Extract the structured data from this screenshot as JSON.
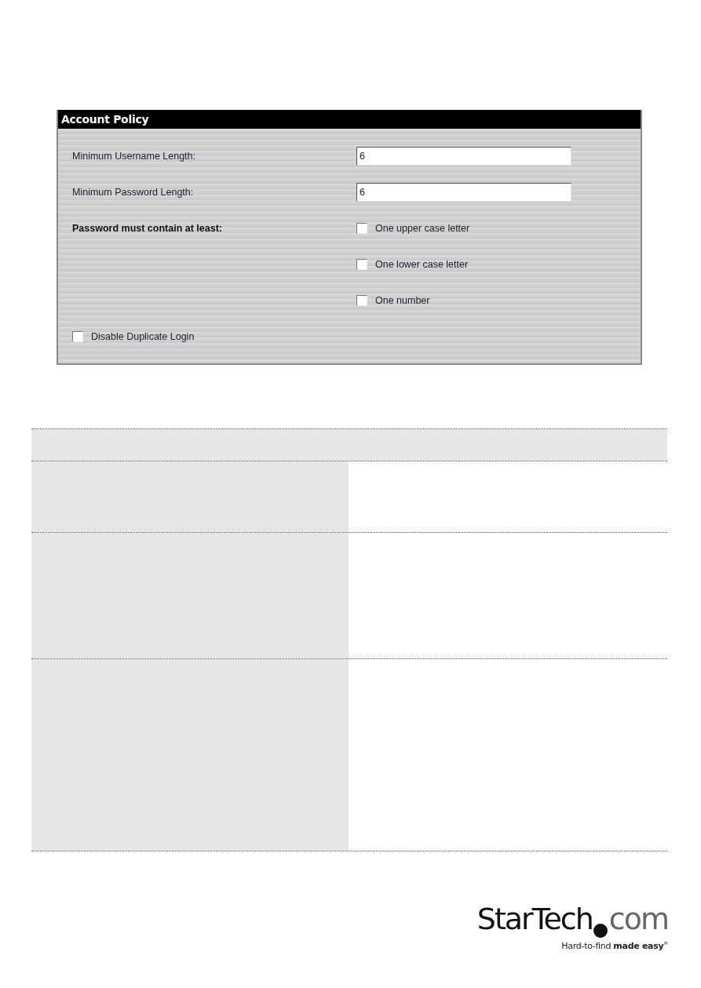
{
  "panel": {
    "title": "Account Policy",
    "fields": [
      {
        "label": "Minimum Username Length:",
        "value": "6"
      },
      {
        "label": "Minimum Password Length:",
        "value": "6"
      }
    ],
    "requirement_label": "Password must contain at least:",
    "requirements": [
      {
        "label": "One upper case letter",
        "checked": false
      },
      {
        "label": "One lower case letter",
        "checked": false
      },
      {
        "label": "One number",
        "checked": false
      }
    ],
    "disable_duplicate_login": {
      "label": "Disable Duplicate Login",
      "checked": false
    }
  },
  "logo": {
    "brand": "StarTech",
    "suffix": "com",
    "tagline": "Hard-to-find **made easy**$^{®}$"
  }
}
